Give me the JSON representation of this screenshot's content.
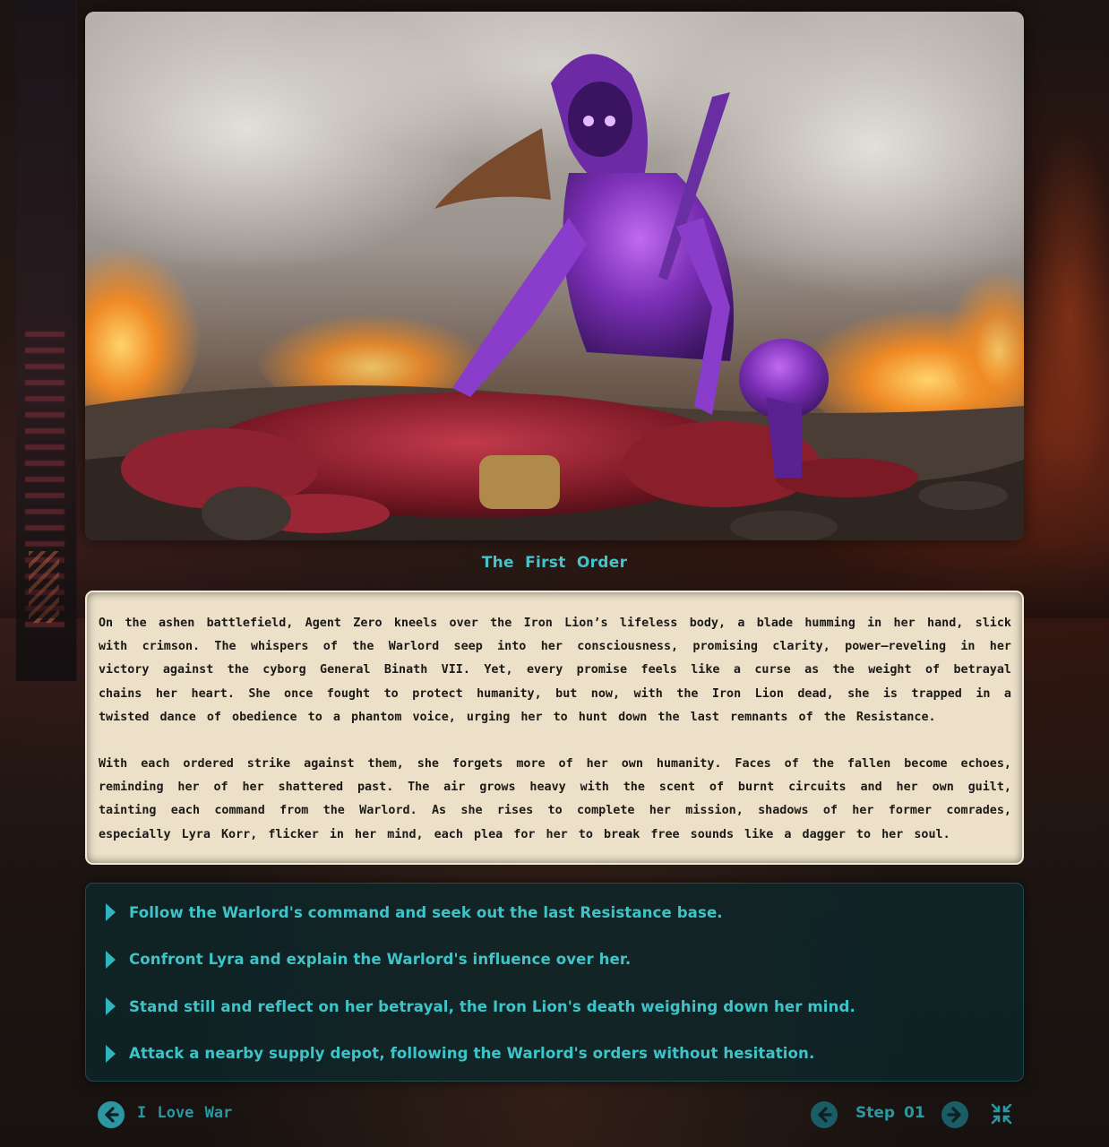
{
  "story": {
    "title": "The First Order",
    "paragraphs": [
      "On the ashen battlefield, Agent Zero kneels over the Iron Lion’s lifeless body, a blade humming in her hand, slick with crimson. The whispers of the Warlord seep into her consciousness, promising clarity, power—reveling in her victory against the cyborg General Binath VII. Yet, every promise feels like a curse as the weight of betrayal chains her heart. She once fought to protect humanity, but now, with the Iron Lion dead, she is trapped in a twisted dance of obedience to a phantom voice, urging her to hunt down the last remnants of the Resistance.",
      "With each ordered strike against them, she forgets more of her own humanity. Faces of the fallen become echoes, reminding her of her shattered past. The air grows heavy with the scent of burnt circuits and her own guilt, tainting each command from the Warlord. As she rises to complete her mission, shadows of her former comrades, especially Lyra Korr, flicker in her mind, each plea for her to break free sounds like a dagger to her soul."
    ]
  },
  "choices": [
    "Follow the Warlord's command and seek out the last Resistance base.",
    "Confront Lyra and explain the Warlord's influence over her.",
    "Stand still and reflect on her betrayal, the Iron Lion's death weighing down her mind.",
    "Attack a nearby supply depot, following the Warlord's orders without hesitation."
  ],
  "footer": {
    "back_label": "I Love War",
    "step_label": "Step 01"
  },
  "icons": {
    "back": "arrow-left-circle-icon",
    "prev": "arrow-left-circle-icon",
    "next": "arrow-right-circle-icon",
    "fullscreen": "collapse-icon",
    "choice": "triangle-right-icon"
  },
  "colors": {
    "accent": "#3ec4c8",
    "paper": "#ece0c8",
    "choice_panel": "#0c262a"
  }
}
